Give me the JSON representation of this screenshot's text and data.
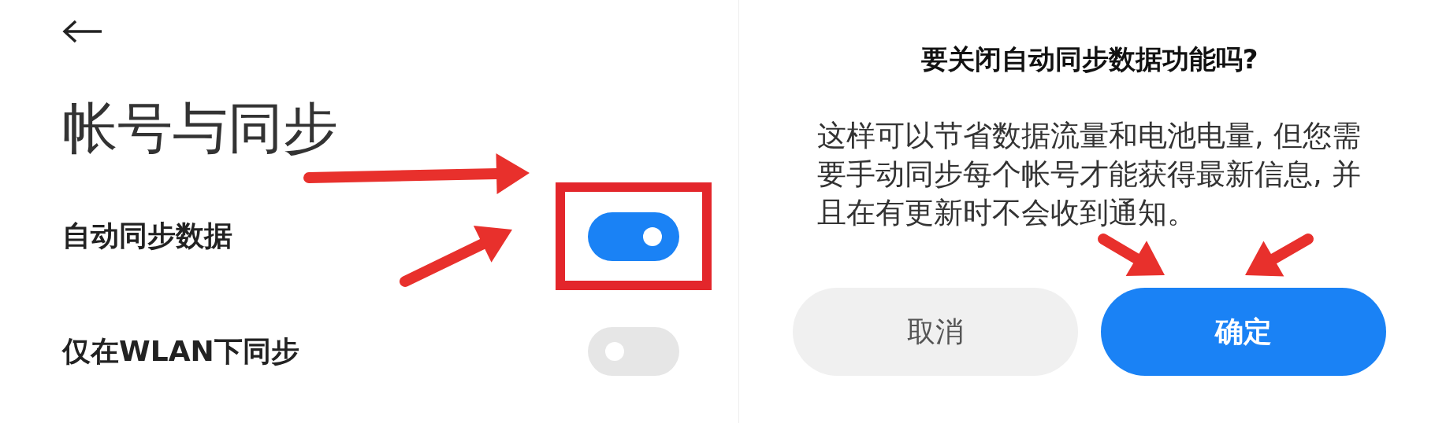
{
  "left_screen": {
    "title": "帐号与同步",
    "settings": [
      {
        "label": "自动同步数据",
        "on": true,
        "highlighted": true
      },
      {
        "label": "仅在WLAN下同步",
        "on": false,
        "highlighted": false
      }
    ]
  },
  "dialog": {
    "title": "要关闭自动同步数据功能吗?",
    "message": "这样可以节省数据流量和电池电量, 但您需要手动同步每个帐号才能获得最新信息, 并且在有更新时不会收到通知。",
    "buttons": [
      {
        "label": "取消",
        "kind": "secondary"
      },
      {
        "label": "确定",
        "kind": "primary"
      }
    ]
  }
}
